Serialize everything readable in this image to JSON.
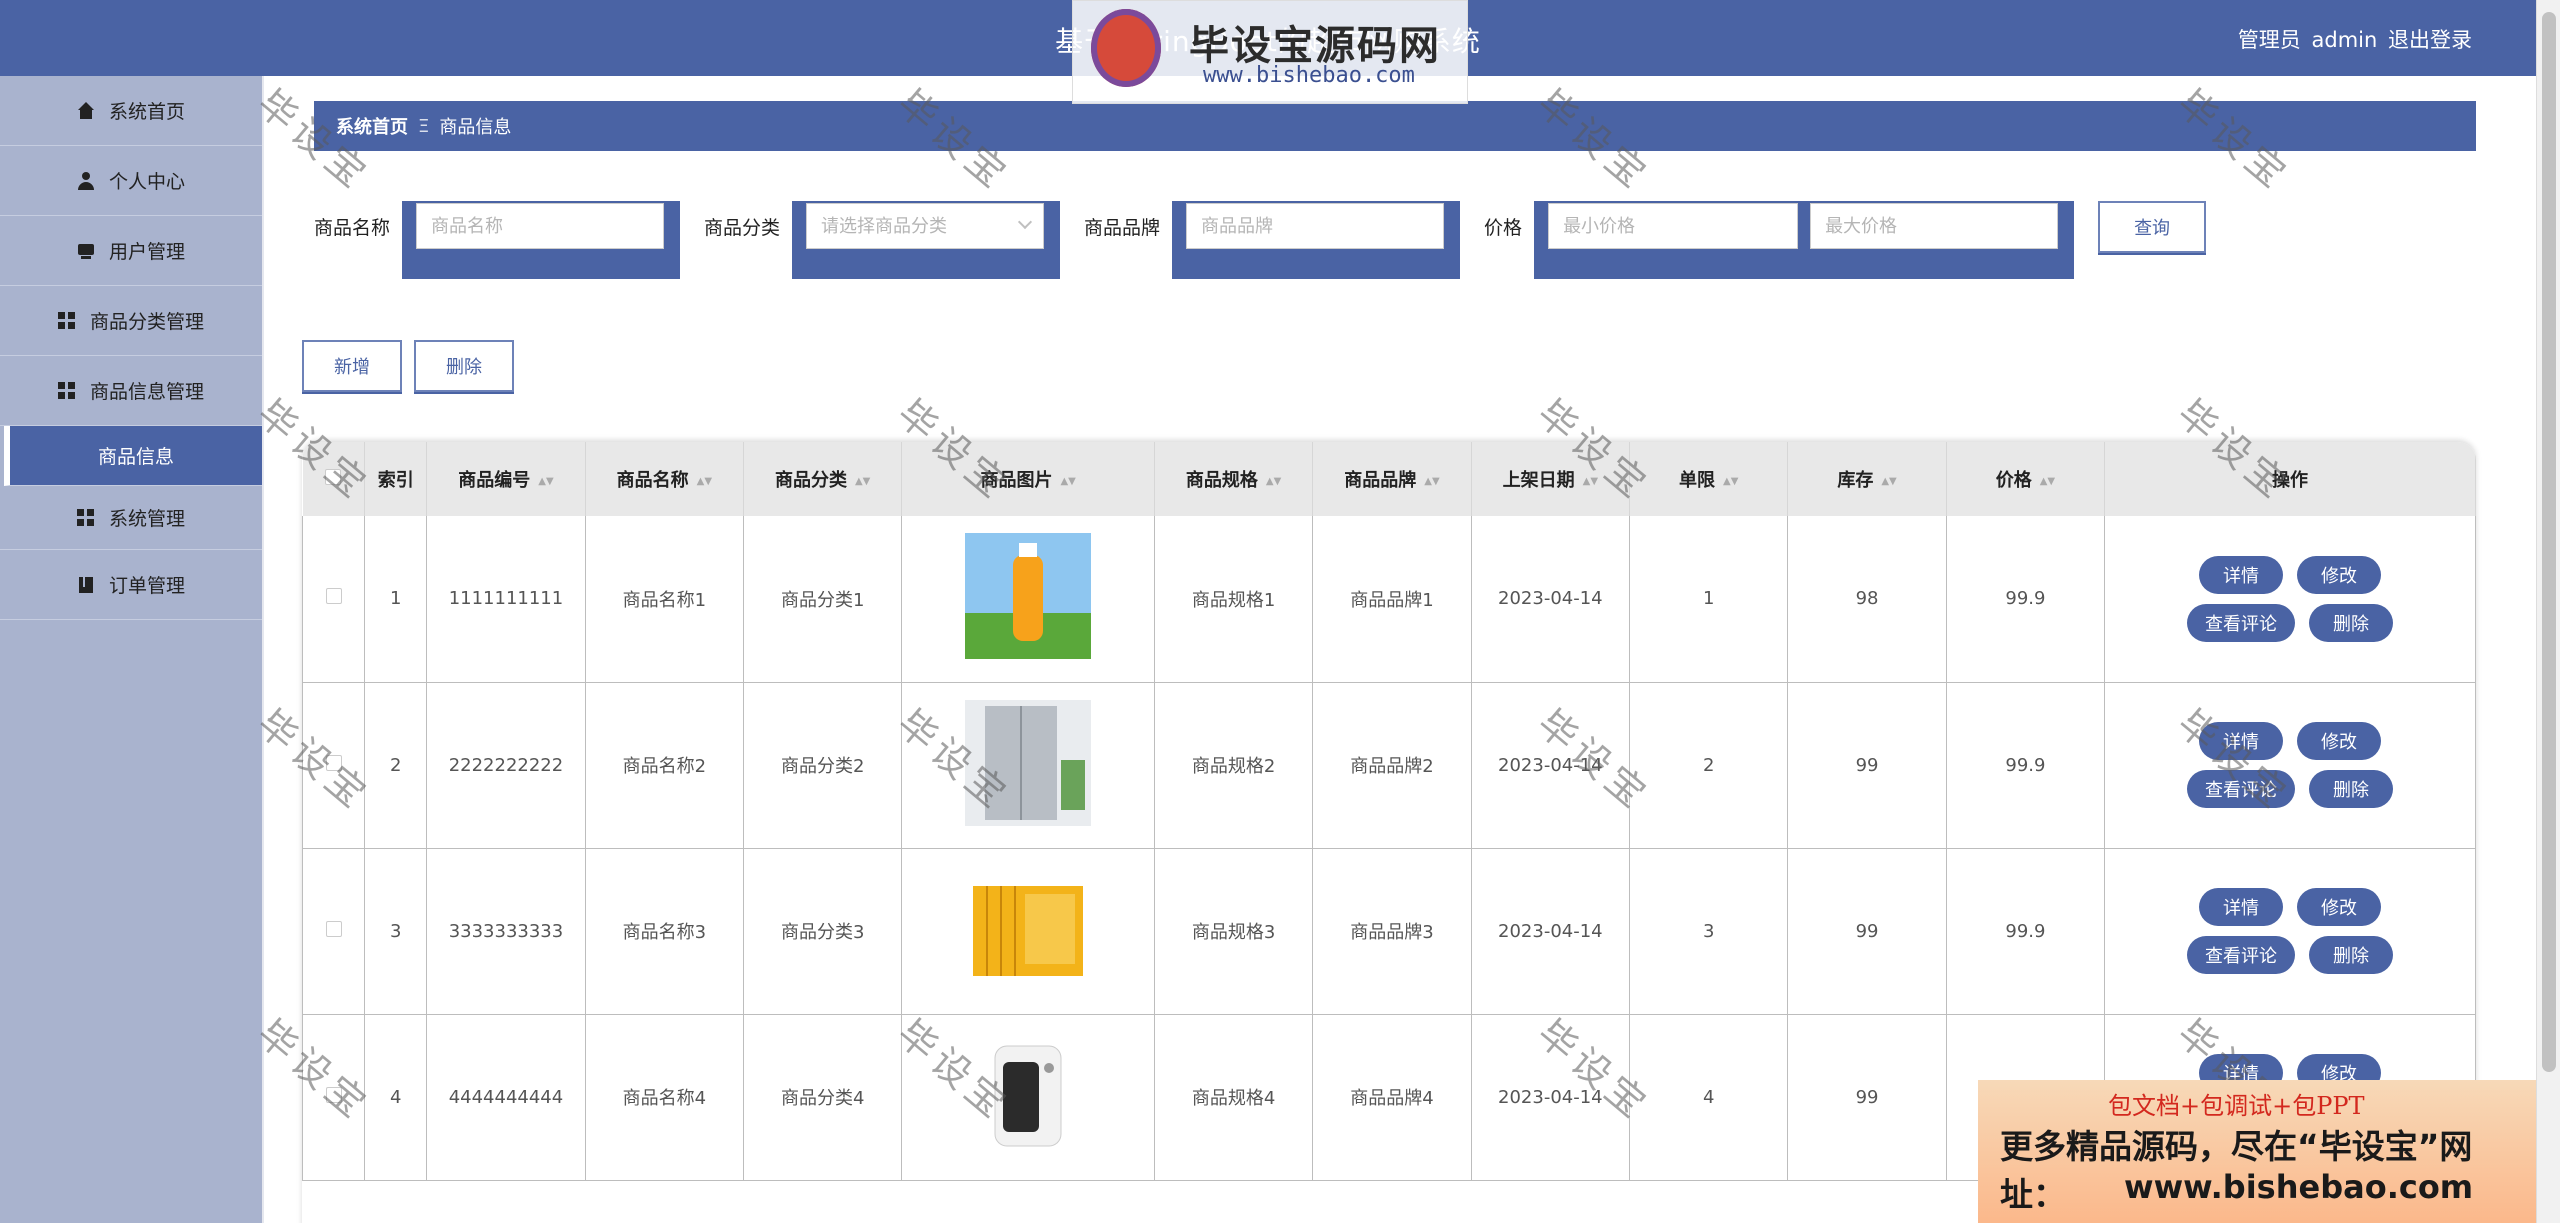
{
  "header": {
    "title": "基于SpringBoot的超市网购系统",
    "role": "管理员",
    "username": "admin",
    "logout": "退出登录"
  },
  "sidebar": {
    "items": [
      {
        "label": "系统首页",
        "icon": "home-icon"
      },
      {
        "label": "个人中心",
        "icon": "user-icon"
      },
      {
        "label": "用户管理",
        "icon": "id-card-icon"
      },
      {
        "label": "商品分类管理",
        "icon": "grid-icon"
      },
      {
        "label": "商品信息管理",
        "icon": "grid-icon"
      },
      {
        "label": "商品信息",
        "icon": "",
        "active": true
      },
      {
        "label": "系统管理",
        "icon": "grid-icon"
      },
      {
        "label": "订单管理",
        "icon": "book-icon"
      }
    ]
  },
  "breadcrumb": {
    "home": "系统首页",
    "separator": "Ξ",
    "current": "商品信息"
  },
  "filters": {
    "name_label": "商品名称",
    "name_placeholder": "商品名称",
    "category_label": "商品分类",
    "category_placeholder": "请选择商品分类",
    "brand_label": "商品品牌",
    "brand_placeholder": "商品品牌",
    "price_label": "价格",
    "min_placeholder": "最小价格",
    "max_placeholder": "最大价格",
    "query": "查询"
  },
  "actions": {
    "add": "新增",
    "delete": "删除"
  },
  "table": {
    "headers": [
      "索引",
      "商品编号",
      "商品名称",
      "商品分类",
      "商品图片",
      "商品规格",
      "商品品牌",
      "上架日期",
      "单限",
      "库存",
      "价格",
      "操作"
    ],
    "buttons": {
      "detail": "详情",
      "edit": "修改",
      "comments": "查看评论",
      "delete": "删除"
    },
    "rows": [
      {
        "index": "1",
        "code": "1111111111",
        "name": "商品名称1",
        "category": "商品分类1",
        "image": "orange-juice",
        "spec": "商品规格1",
        "brand": "商品品牌1",
        "date": "2023-04-14",
        "limit": "1",
        "stock": "98",
        "price": "99.9"
      },
      {
        "index": "2",
        "code": "2222222222",
        "name": "商品名称2",
        "category": "商品分类2",
        "image": "refrigerator",
        "spec": "商品规格2",
        "brand": "商品品牌2",
        "date": "2023-04-14",
        "limit": "2",
        "stock": "99",
        "price": "99.9"
      },
      {
        "index": "3",
        "code": "3333333333",
        "name": "商品名称3",
        "category": "商品分类3",
        "image": "books",
        "spec": "商品规格3",
        "brand": "商品品牌3",
        "date": "2023-04-14",
        "limit": "3",
        "stock": "99",
        "price": "99.9"
      },
      {
        "index": "4",
        "code": "4444444444",
        "name": "商品名称4",
        "category": "商品分类4",
        "image": "heater",
        "spec": "商品规格4",
        "brand": "商品品牌4",
        "date": "2023-04-14",
        "limit": "4",
        "stock": "99",
        "price": ""
      }
    ]
  },
  "watermark": {
    "text": "毕设宝",
    "logo_brand": "毕设宝源码网",
    "logo_url": "www.bishebao.com",
    "ad_line1": "包文档+包调试+包PPT",
    "ad_line2": "更多精品源码，尽在“毕设宝”网址：",
    "ad_line3": "www.bishebao.com"
  },
  "colors": {
    "primary": "#4A63A4",
    "sidebar": "#A9B3CE"
  }
}
